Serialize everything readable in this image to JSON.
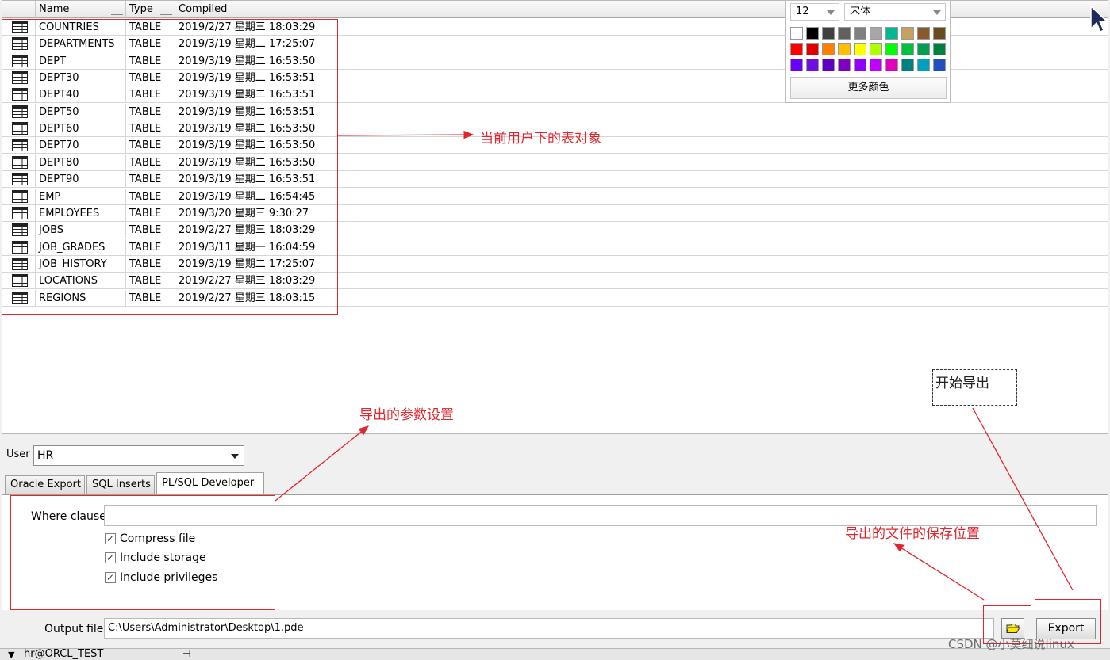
{
  "grid": {
    "columns": [
      {
        "key": "name",
        "label": "Name"
      },
      {
        "key": "type",
        "label": "Type"
      },
      {
        "key": "compiled",
        "label": "Compiled"
      }
    ],
    "row_icon": "table-grid-icon",
    "rows": [
      {
        "name": "COUNTRIES",
        "type": "TABLE",
        "compiled": "2019/2/27 星期三  18:03:29"
      },
      {
        "name": "DEPARTMENTS",
        "type": "TABLE",
        "compiled": "2019/3/19 星期二  17:25:07"
      },
      {
        "name": "DEPT",
        "type": "TABLE",
        "compiled": "2019/3/19 星期二  16:53:50"
      },
      {
        "name": "DEPT30",
        "type": "TABLE",
        "compiled": "2019/3/19 星期二  16:53:51"
      },
      {
        "name": "DEPT40",
        "type": "TABLE",
        "compiled": "2019/3/19 星期二  16:53:51"
      },
      {
        "name": "DEPT50",
        "type": "TABLE",
        "compiled": "2019/3/19 星期二  16:53:51"
      },
      {
        "name": "DEPT60",
        "type": "TABLE",
        "compiled": "2019/3/19 星期二  16:53:50"
      },
      {
        "name": "DEPT70",
        "type": "TABLE",
        "compiled": "2019/3/19 星期二  16:53:50"
      },
      {
        "name": "DEPT80",
        "type": "TABLE",
        "compiled": "2019/3/19 星期二  16:53:50"
      },
      {
        "name": "DEPT90",
        "type": "TABLE",
        "compiled": "2019/3/19 星期二  16:53:51"
      },
      {
        "name": "EMP",
        "type": "TABLE",
        "compiled": "2019/3/19 星期二  16:54:45"
      },
      {
        "name": "EMPLOYEES",
        "type": "TABLE",
        "compiled": "2019/3/20 星期三  9:30:27"
      },
      {
        "name": "JOBS",
        "type": "TABLE",
        "compiled": "2019/2/27 星期三  18:03:29"
      },
      {
        "name": "JOB_GRADES",
        "type": "TABLE",
        "compiled": "2019/3/11 星期一  16:04:59"
      },
      {
        "name": "JOB_HISTORY",
        "type": "TABLE",
        "compiled": "2019/3/19 星期二  17:25:07"
      },
      {
        "name": "LOCATIONS",
        "type": "TABLE",
        "compiled": "2019/2/27 星期三  18:03:29"
      },
      {
        "name": "REGIONS",
        "type": "TABLE",
        "compiled": "2019/2/27 星期三  18:03:15"
      }
    ]
  },
  "color_popup": {
    "font_size": "12",
    "font_name": "宋体",
    "more_colors_label": "更多颜色",
    "palette": [
      [
        "#ffffff",
        "#000000",
        "#404040",
        "#606060",
        "#808080",
        "#a6a6a6",
        "#00b894",
        "#c8a060",
        "#8b5a2b",
        "#6b4a1e"
      ],
      [
        "#ff0000",
        "#e00000",
        "#ff8000",
        "#ffc000",
        "#ffff00",
        "#b0ff00",
        "#00ff00",
        "#00c040",
        "#00a050",
        "#008040"
      ],
      [
        "#6a00ff",
        "#7010e0",
        "#6000c0",
        "#8000c0",
        "#9000ff",
        "#c000ff",
        "#e000c0",
        "#008080",
        "#00a0c0",
        "#2050c0"
      ]
    ]
  },
  "user": {
    "label": "User",
    "value": "HR"
  },
  "tabs": [
    {
      "label": "Oracle Export",
      "active": false
    },
    {
      "label": "SQL Inserts",
      "active": false
    },
    {
      "label": "PL/SQL Developer",
      "active": true
    }
  ],
  "options": {
    "where_label": "Where clause",
    "where_value": "",
    "checkboxes": [
      {
        "label": "Compress file",
        "checked": true
      },
      {
        "label": "Include storage",
        "checked": true
      },
      {
        "label": "Include privileges",
        "checked": true
      }
    ]
  },
  "output": {
    "label": "Output file",
    "value": "C:\\Users\\Administrator\\Desktop\\1.pde",
    "browse_icon": "folder-open-icon",
    "export_label": "Export"
  },
  "status": {
    "connection": "hr@ORCL_TEST"
  },
  "annotations": {
    "tables": "当前用户下的表对象",
    "params": "导出的参数设置",
    "start": "开始导出",
    "save": "导出的文件的保存位置"
  },
  "watermark": "CSDN @小莫细说linux",
  "accent_color": "#e1252b"
}
